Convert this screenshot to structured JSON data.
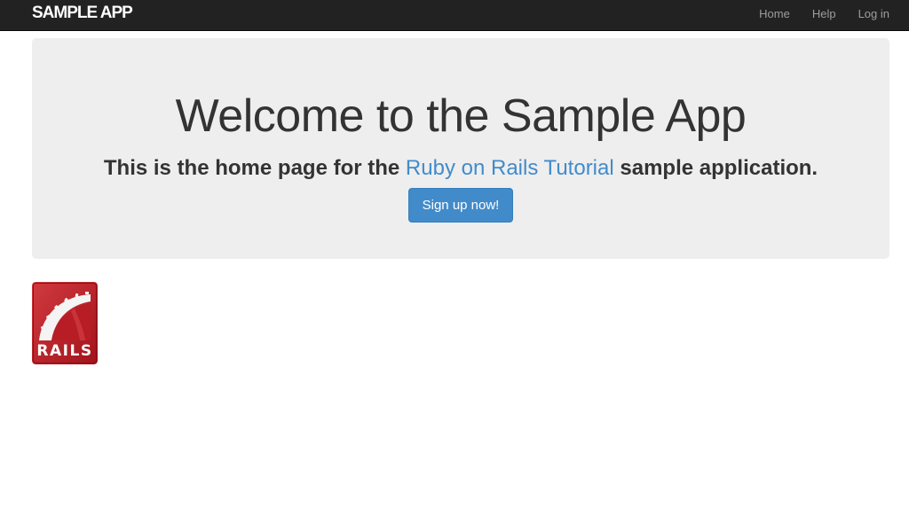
{
  "navbar": {
    "logo": "SAMPLE APP",
    "links": [
      {
        "label": "Home"
      },
      {
        "label": "Help"
      },
      {
        "label": "Log in"
      }
    ]
  },
  "jumbotron": {
    "title": "Welcome to the Sample App",
    "subtitle_before": "This is the home page for the ",
    "subtitle_link": "Ruby on Rails Tutorial",
    "subtitle_after": " sample application.",
    "signup_button": "Sign up now!"
  },
  "footer_logo": {
    "text": "RAILS",
    "icon": "rails-logo",
    "brand_color": "#c4222b"
  },
  "colors": {
    "navbar_bg": "#222222",
    "link": "#428bca",
    "jumbotron_bg": "#eeeeee"
  }
}
